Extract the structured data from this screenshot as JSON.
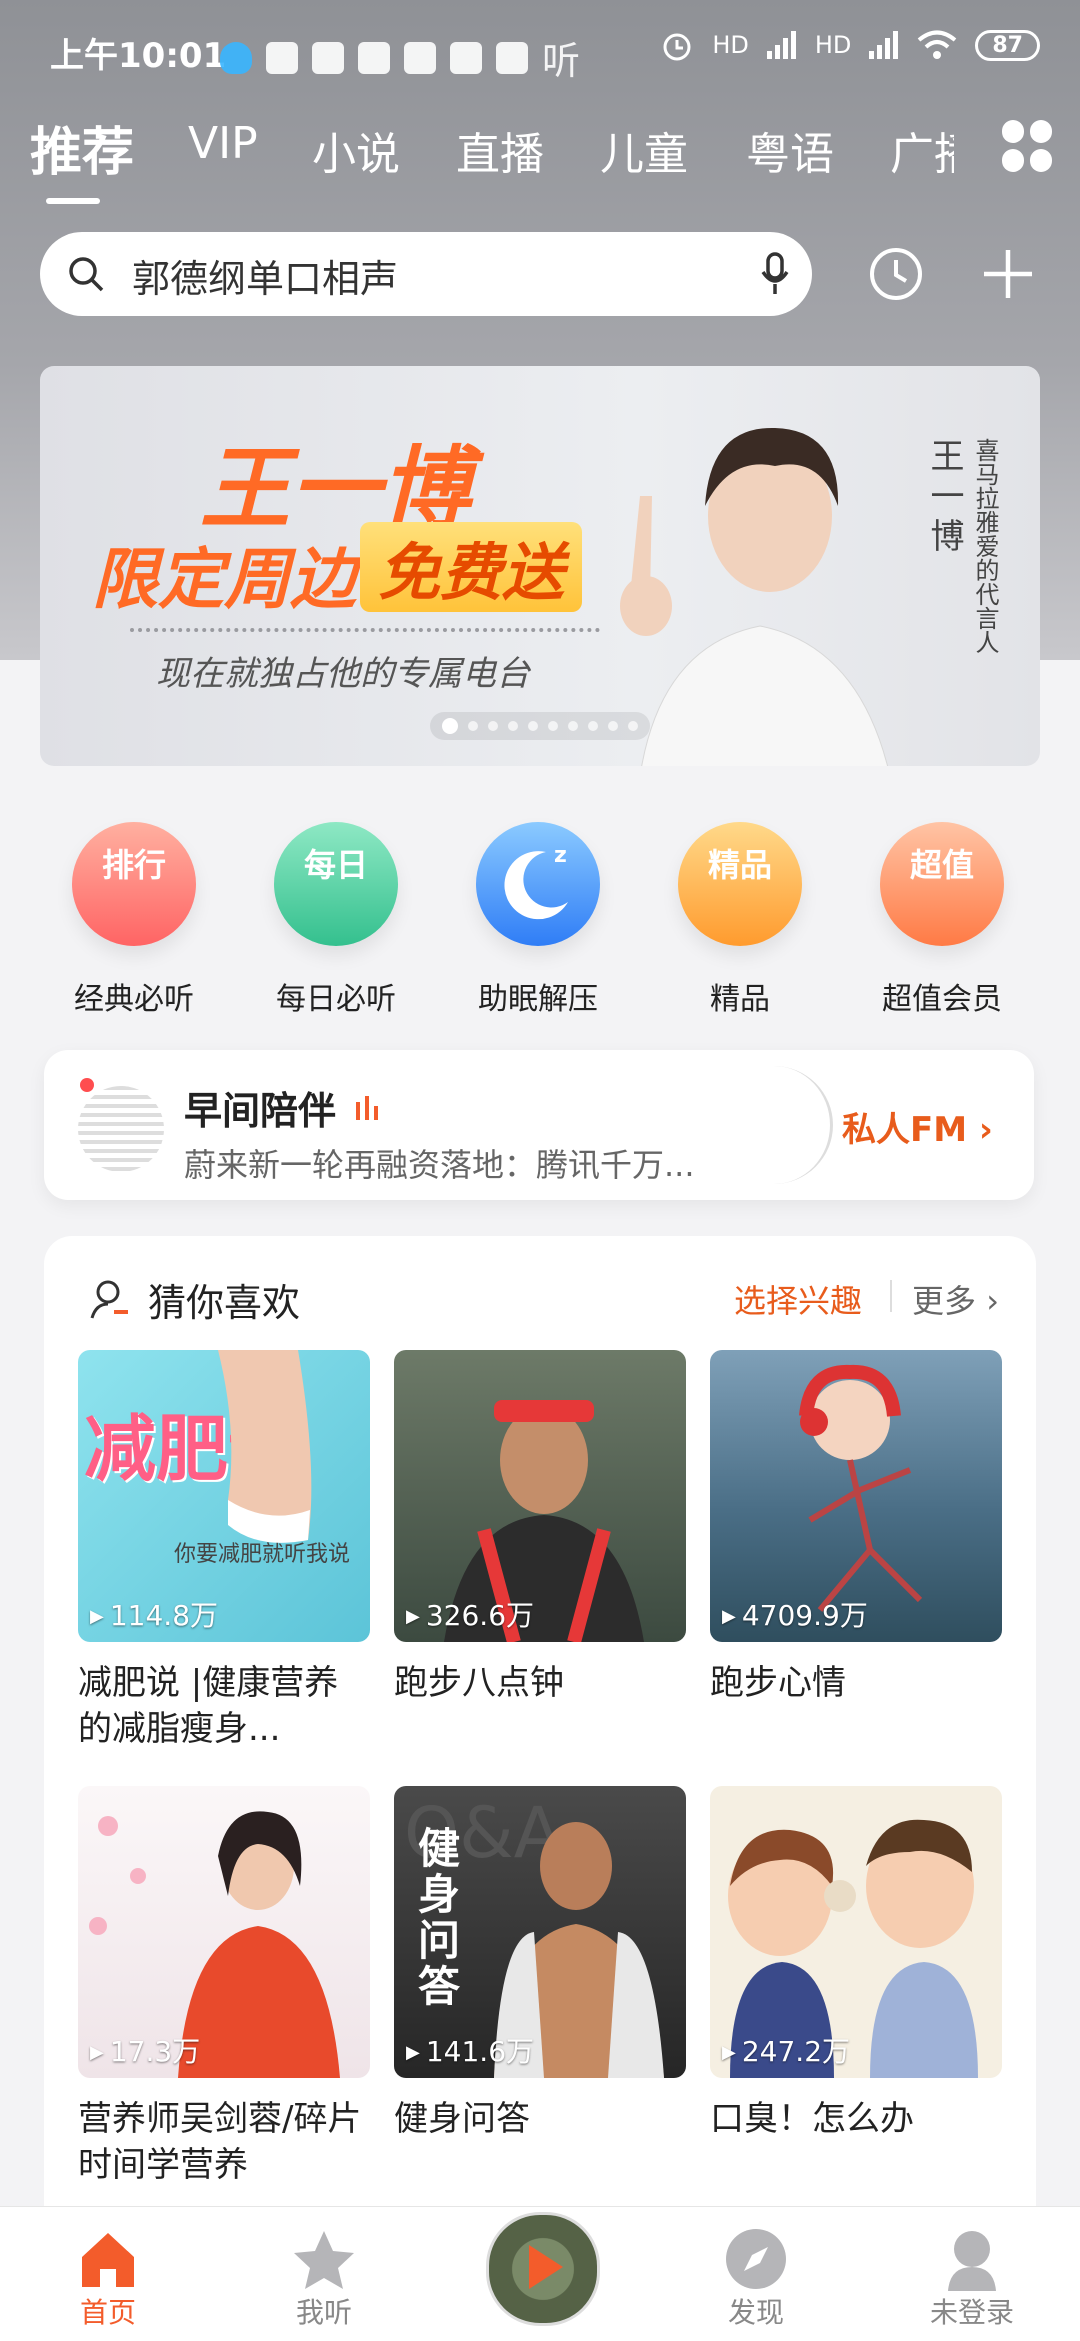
{
  "status_bar": {
    "time": "上午10:01",
    "listen_glyph": "听",
    "hd1": "HD",
    "hd2": "HD",
    "battery": "87"
  },
  "tabs": [
    {
      "label": "推荐",
      "active": true
    },
    {
      "label": "VIP"
    },
    {
      "label": "小说"
    },
    {
      "label": "直播"
    },
    {
      "label": "儿童"
    },
    {
      "label": "粤语"
    },
    {
      "label": "广播"
    }
  ],
  "search": {
    "value": "郭德纲单口相声"
  },
  "banner": {
    "headline": "王一博",
    "line1": "限定周边",
    "line2": "免费送",
    "tagline": "现在就独占他的专属电台",
    "vertical_name": "王一博",
    "vertical_caption": "喜马拉雅爱的代言人",
    "slides": 10,
    "active_slide": 1
  },
  "quick_entries": [
    {
      "badge": "排行",
      "label": "经典必听",
      "color_a": "#ff8a7a",
      "color_b": "#ff5b5b"
    },
    {
      "badge": "每日",
      "label": "每日必听",
      "color_a": "#6fe0b4",
      "color_b": "#2fbf8a"
    },
    {
      "badge": "",
      "label": "助眠解压",
      "color_a": "#7cc2ff",
      "color_b": "#2f7df6"
    },
    {
      "badge": "精品",
      "label": "精品",
      "color_a": "#ffcf6b",
      "color_b": "#ff9b2e"
    },
    {
      "badge": "超值",
      "label": "超值会员",
      "color_a": "#ffb089",
      "color_b": "#ff7a45"
    }
  ],
  "fm": {
    "title": "早间陪伴",
    "description": "蔚来新一轮再融资落地：腾讯千万...",
    "private_label": "私人FM",
    "chevron": "›"
  },
  "guess": {
    "title": "猜你喜欢",
    "pick_label": "选择兴趣",
    "more_label": "更多",
    "more_chevron": "›",
    "cards": [
      {
        "title": "减肥说 |健康营养的减脂瘦身...",
        "plays": "114.8万",
        "thumb_text": "减肥说",
        "thumb_sub": "你要减肥就听我说",
        "bg": "#7fd8e6"
      },
      {
        "title": "跑步八点钟",
        "plays": "326.6万",
        "thumb_text": "",
        "thumb_sub": "",
        "bg": "#4a5a4c"
      },
      {
        "title": "跑步心情",
        "plays": "4709.9万",
        "thumb_text": "",
        "thumb_sub": "",
        "bg": "#3f6a8a"
      },
      {
        "title": "营养师吴剑蓉/碎片时间学营养",
        "plays": "17.3万",
        "thumb_text": "",
        "thumb_sub": "",
        "bg": "#f4eef0"
      },
      {
        "title": "健身问答",
        "plays": "141.6万",
        "thumb_text": "健身问答",
        "thumb_sub": "Q&A",
        "bg": "#3a3a3a"
      },
      {
        "title": "口臭！怎么办",
        "plays": "247.2万",
        "thumb_text": "",
        "thumb_sub": "",
        "bg": "#f1e8d8"
      }
    ]
  },
  "bottom_nav": [
    {
      "label": "首页",
      "icon": "home-icon",
      "active": true
    },
    {
      "label": "我听",
      "icon": "star-icon"
    },
    {
      "label": "发现",
      "icon": "compass-icon"
    },
    {
      "label": "未登录",
      "icon": "user-icon"
    }
  ],
  "colors": {
    "accent": "#f35c2b",
    "banner_orange": "#ff6a25"
  }
}
